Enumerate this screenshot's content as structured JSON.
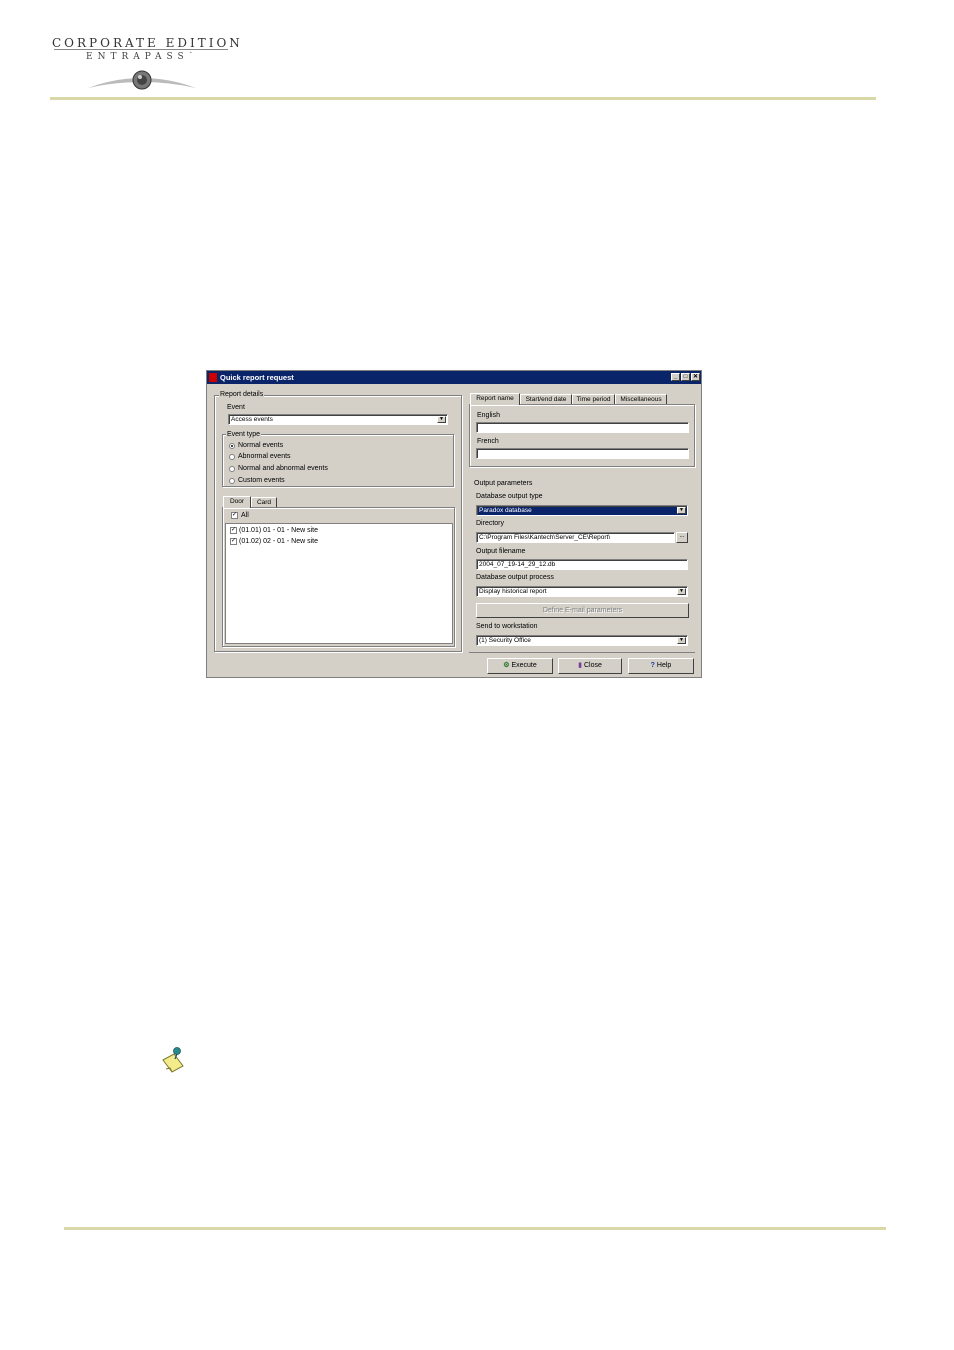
{
  "header": {
    "logo_top": "CORPORATE EDITION",
    "logo_bottom": "ENTRAPASS˙"
  },
  "dialog": {
    "title": "Quick report request",
    "titlebar_buttons": [
      "_",
      "□",
      "✕"
    ],
    "report_details": {
      "label": "Report details",
      "event_label": "Event",
      "event_value": "Access events",
      "event_type_label": "Event type",
      "event_types": [
        {
          "label": "Normal events",
          "selected": true
        },
        {
          "label": "Abnormal events",
          "selected": false
        },
        {
          "label": "Normal and abnormal events",
          "selected": false
        },
        {
          "label": "Custom events",
          "selected": false
        }
      ],
      "tabs": [
        "Door",
        "Card"
      ],
      "all_label": "All",
      "items": [
        "(01.01) 01 - 01 - New site",
        "(01.02) 02 - 01 - New site"
      ]
    },
    "right_tabs": [
      "Report name",
      "Start/end date",
      "Time period",
      "Miscellaneous"
    ],
    "report_name": {
      "english_label": "English",
      "english_value": "",
      "french_label": "French",
      "french_value": ""
    },
    "output": {
      "label": "Output parameters",
      "db_type_label": "Database output type",
      "db_type_value": "Paradox database",
      "directory_label": "Directory",
      "directory_value": "C:\\Program Files\\Kantech\\Server_CE\\Report\\",
      "browse_label": "...",
      "filename_label": "Output filename",
      "filename_value": "2004_07_19-14_29_12.db",
      "process_label": "Database output process",
      "process_value": "Display historical report",
      "email_button": "Define E-mail parameters",
      "workstation_label": "Send to workstation",
      "workstation_value": "(1)  Security Office"
    },
    "buttons": {
      "execute": "Execute",
      "close": "Close",
      "help": "Help"
    }
  }
}
